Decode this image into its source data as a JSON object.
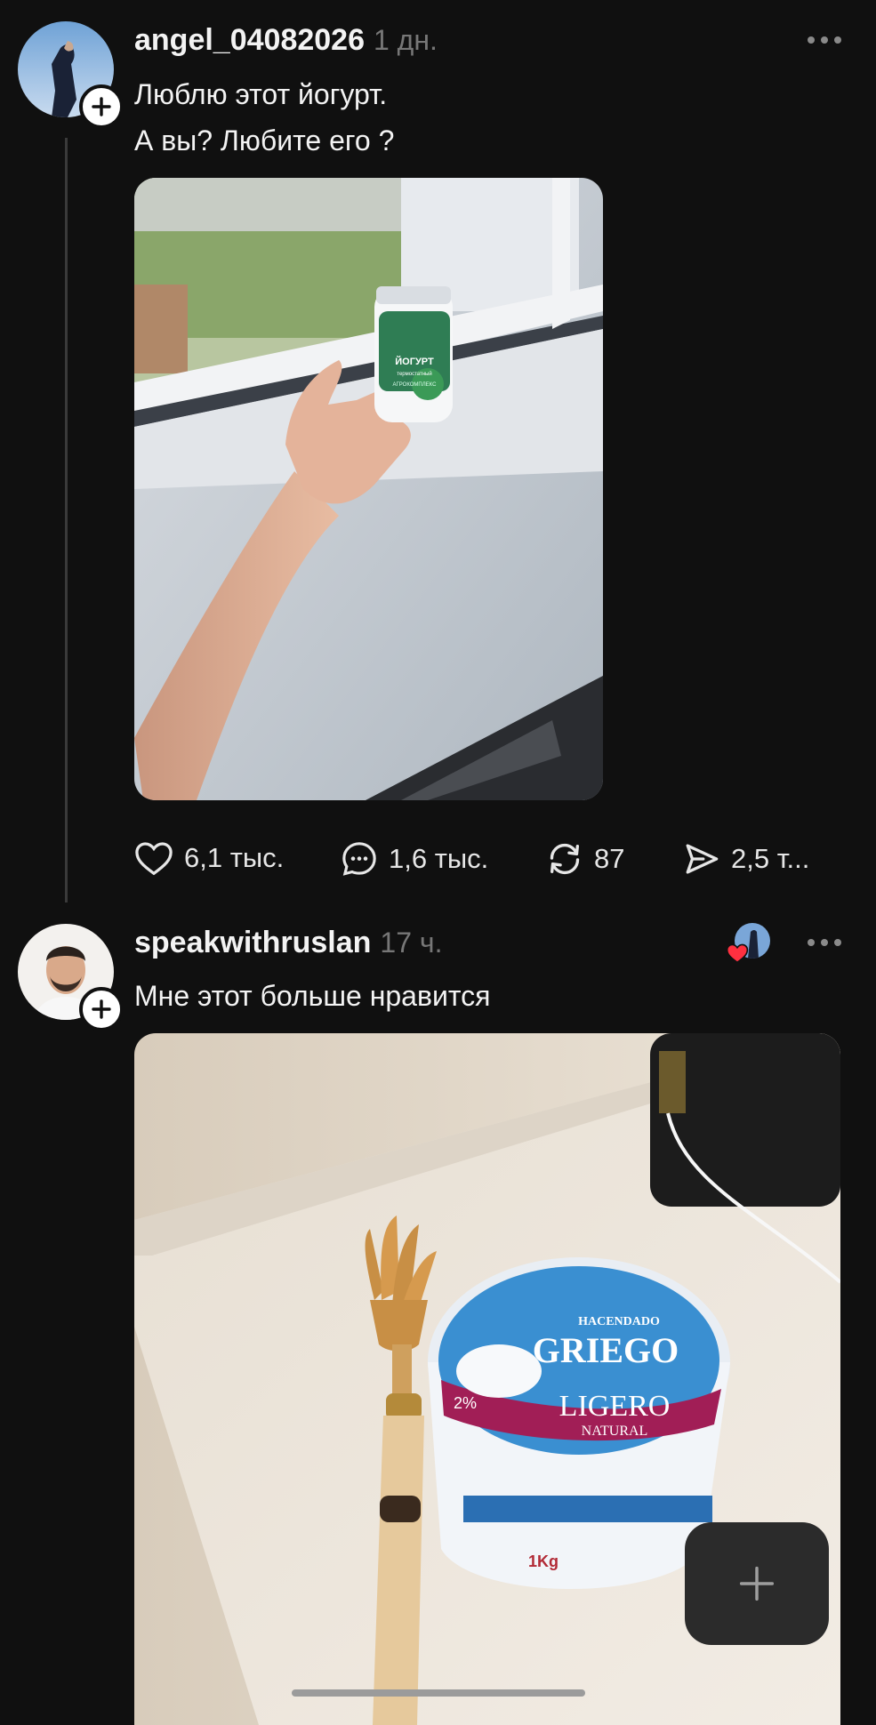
{
  "post1": {
    "username": "angel_04082026",
    "time": "1 дн.",
    "text_line1": "Люблю этот йогурт.",
    "text_line2": "А вы? Любите его ?",
    "likes": "6,1 тыс.",
    "comments": "1,6 тыс.",
    "reposts": "87",
    "shares": "2,5 т...",
    "jar_label1": "ЙОГУРТ",
    "jar_label2": "термостатный",
    "jar_label3": "АГРОКОМПЛЕКС"
  },
  "post2": {
    "username": "speakwithruslan",
    "time": "17 ч.",
    "text": "Мне этот больше нравится",
    "tub_brand": "HACENDADO",
    "tub_name": "GRIEGO",
    "tub_variant": "LIGERO",
    "tub_sub": "NATURAL",
    "tub_pct": "2%",
    "tub_weight": "1Kg"
  },
  "icons": {
    "like": "heart-icon",
    "comment": "comment-bubble-icon",
    "repost": "repost-icon",
    "share": "send-icon",
    "more": "more-dots-icon",
    "follow": "plus-icon",
    "fab": "plus-icon"
  },
  "colors": {
    "background": "#101010",
    "text": "#f3f3f3",
    "muted": "#777777",
    "like_red": "#ff3040"
  }
}
